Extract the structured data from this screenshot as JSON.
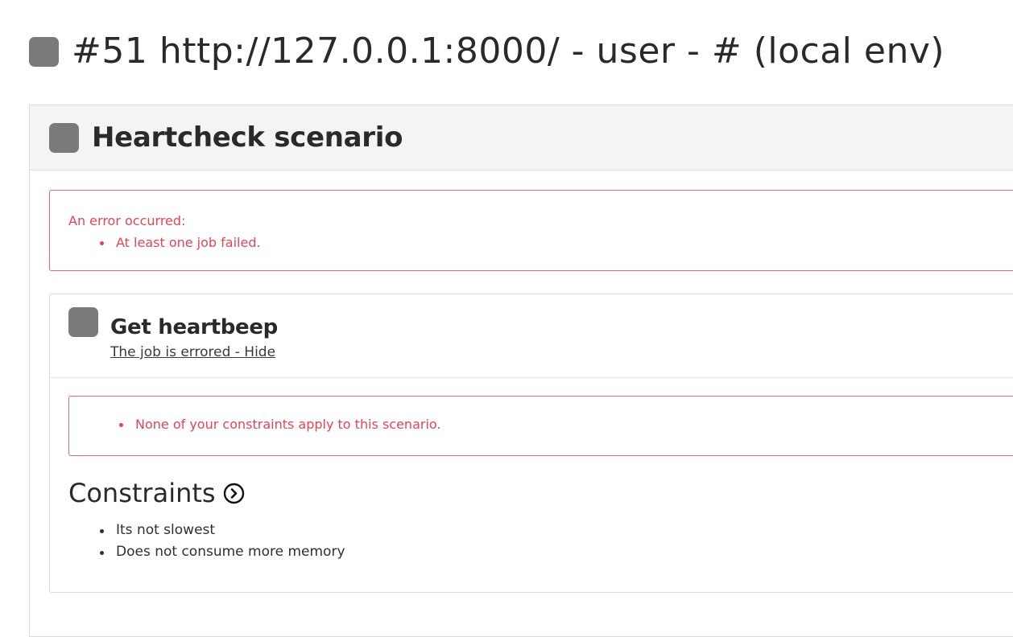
{
  "page": {
    "title": "#51 http://127.0.0.1:8000/ - user - # (local env)"
  },
  "scenario": {
    "title": "Heartcheck scenario",
    "error": {
      "title": "An error occurred:",
      "items": [
        "At least one job failed."
      ]
    }
  },
  "job": {
    "title": "Get heartbeep",
    "status_link": "The job is errored - Hide",
    "error": {
      "items": [
        "None of your constraints apply to this scenario."
      ]
    },
    "constraints": {
      "title": "Constraints",
      "items": [
        "Its not slowest",
        "Does not consume more memory"
      ]
    }
  },
  "colors": {
    "status": "#7a7a7a",
    "error": "#e34556",
    "error_border": "#e0697a"
  },
  "icons": {
    "status": "status-square-icon",
    "toggle": "chevron-right-circle-icon"
  }
}
